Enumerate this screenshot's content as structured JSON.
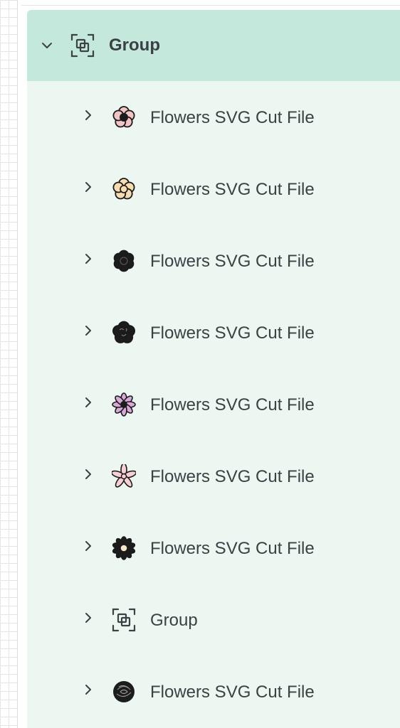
{
  "layers_panel": {
    "group": {
      "label": "Group",
      "expanded": true,
      "icon": "group-icon"
    },
    "children": [
      {
        "label": "Flowers SVG Cut File",
        "icon": "flower-icon",
        "petal": "#f4c4c4",
        "center": "#1c1c1c",
        "style": "round"
      },
      {
        "label": "Flowers SVG Cut File",
        "icon": "flower-icon",
        "petal": "#f6dcae",
        "center": "#f6dcae",
        "style": "round-outline"
      },
      {
        "label": "Flowers SVG Cut File",
        "icon": "flower-icon",
        "petal": "#1c1c1c",
        "center": "#1c1c1c",
        "style": "solid"
      },
      {
        "label": "Flowers SVG Cut File",
        "icon": "flower-icon",
        "petal": "#1c1c1c",
        "center": "#1c1c1c",
        "style": "doodle"
      },
      {
        "label": "Flowers SVG Cut File",
        "icon": "flower-icon",
        "petal": "#d8a8d6",
        "center": "#1c1c1c",
        "style": "pointed"
      },
      {
        "label": "Flowers SVG Cut File",
        "icon": "flower-icon",
        "petal": "#f8cfd2",
        "center": "#f8cfd2",
        "style": "star"
      },
      {
        "label": "Flowers SVG Cut File",
        "icon": "flower-icon",
        "petal": "#1c1c1c",
        "center": "#f6e7c8",
        "style": "daisy"
      },
      {
        "label": "Group",
        "icon": "group-icon"
      },
      {
        "label": "Flowers SVG Cut File",
        "icon": "flower-icon",
        "petal": "#1c1c1c",
        "center": "#1c1c1c",
        "style": "rose"
      }
    ]
  }
}
